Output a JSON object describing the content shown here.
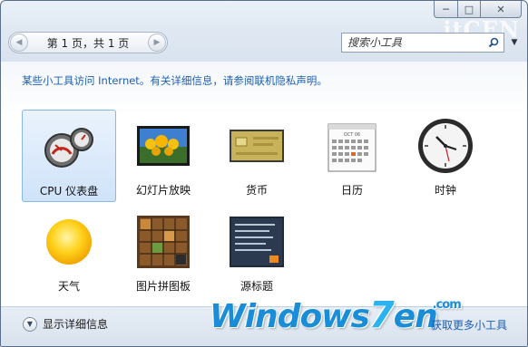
{
  "window": {
    "caption_buttons": {
      "minimize": "─",
      "maximize": "□",
      "close": "✕"
    },
    "watermark_top": "itCEN"
  },
  "nav": {
    "prev_icon": "chevron-left-icon",
    "next_icon": "chevron-right-icon",
    "page_info": "第 1 页，共 1 页"
  },
  "search": {
    "placeholder": "搜索小工具",
    "value": ""
  },
  "notice": "某些小工具访问 Internet。有关详细信息，请参阅联机隐私声明。",
  "gadgets": [
    {
      "label": "CPU 仪表盘",
      "icon": "cpu-meter-icon",
      "selected": true
    },
    {
      "label": "幻灯片放映",
      "icon": "slideshow-icon",
      "selected": false
    },
    {
      "label": "货币",
      "icon": "currency-icon",
      "selected": false
    },
    {
      "label": "日历",
      "icon": "calendar-icon",
      "selected": false
    },
    {
      "label": "时钟",
      "icon": "clock-icon",
      "selected": false
    },
    {
      "label": "天气",
      "icon": "weather-icon",
      "selected": false
    },
    {
      "label": "图片拼图板",
      "icon": "picture-puzzle-icon",
      "selected": false
    },
    {
      "label": "源标题",
      "icon": "feed-headlines-icon",
      "selected": false
    }
  ],
  "calendar_month": "OCT 06",
  "footer": {
    "details_label": "显示详细信息",
    "online_link": "获取更多小工具",
    "brand_main": "Windows",
    "brand_seven": "7",
    "brand_suffix": "en",
    "brand_com": ".com"
  },
  "colors": {
    "link": "#1c5fb0",
    "selection": "#cfe3f9"
  }
}
